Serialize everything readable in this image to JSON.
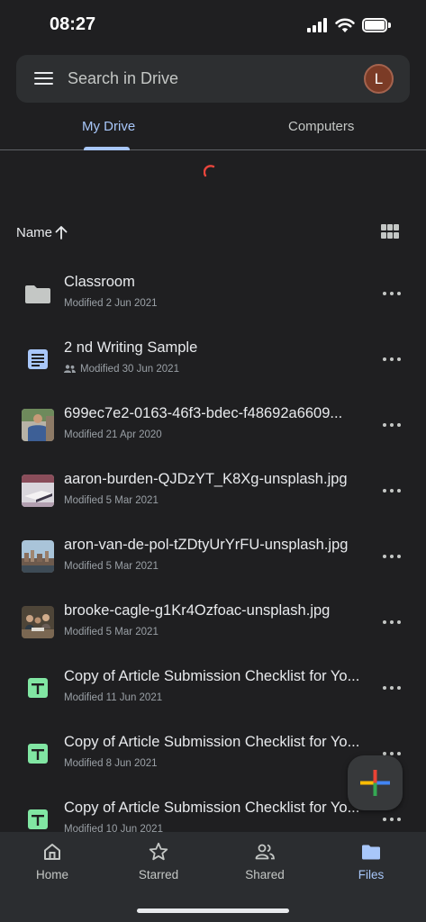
{
  "status": {
    "time": "08:27"
  },
  "search": {
    "placeholder": "Search in Drive",
    "avatar_letter": "L"
  },
  "tabs": [
    {
      "label": "My Drive",
      "active": true
    },
    {
      "label": "Computers",
      "active": false
    }
  ],
  "sort": {
    "label": "Name",
    "direction": "ascending"
  },
  "files": [
    {
      "name": "Classroom",
      "meta": "Modified 2 Jun 2021",
      "type": "folder",
      "shared": false
    },
    {
      "name": "2 nd Writing Sample",
      "meta": "Modified 30 Jun 2021",
      "type": "doc",
      "shared": true
    },
    {
      "name": "699ec7e2-0163-46f3-bdec-f48692a6609...",
      "meta": "Modified 21 Apr 2020",
      "type": "image",
      "shared": false
    },
    {
      "name": "aaron-burden-QJDzYT_K8Xg-unsplash.jpg",
      "meta": "Modified 5 Mar 2021",
      "type": "image",
      "shared": false
    },
    {
      "name": "aron-van-de-pol-tZDtyUrYrFU-unsplash.jpg",
      "meta": "Modified 5 Mar 2021",
      "type": "image",
      "shared": false
    },
    {
      "name": "brooke-cagle-g1Kr4Ozfoac-unsplash.jpg",
      "meta": "Modified 5 Mar 2021",
      "type": "image",
      "shared": false
    },
    {
      "name": "Copy of Article Submission Checklist for Yo...",
      "meta": "Modified 11 Jun 2021",
      "type": "sheet",
      "shared": false
    },
    {
      "name": "Copy of Article Submission Checklist for Yo...",
      "meta": "Modified 8 Jun 2021",
      "type": "sheet",
      "shared": false
    },
    {
      "name": "Copy of Article Submission Checklist for Yo...",
      "meta": "Modified 10 Jun 2021",
      "type": "sheet",
      "shared": false
    }
  ],
  "nav": [
    {
      "label": "Home",
      "active": false
    },
    {
      "label": "Starred",
      "active": false
    },
    {
      "label": "Shared",
      "active": false
    },
    {
      "label": "Files",
      "active": true
    }
  ],
  "colors": {
    "accent": "#a8c7fa",
    "folder": "#c4c7c5",
    "doc": "#a8c7fa",
    "sheet": "#81e6a3"
  }
}
